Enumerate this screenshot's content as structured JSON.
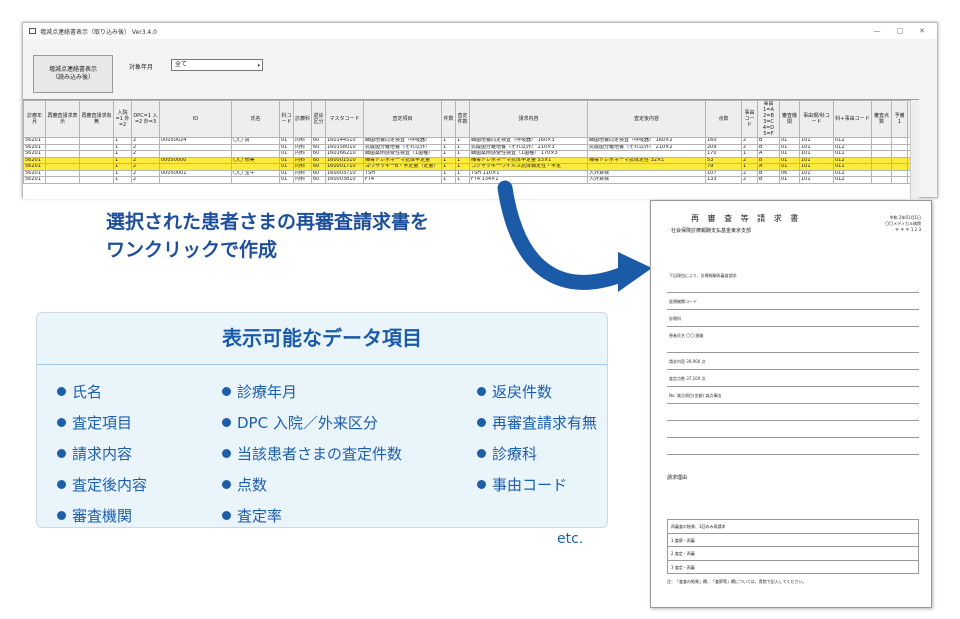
{
  "window": {
    "title": "増減点連絡書表示（取り込み後） Ver3.4.0",
    "controls": [
      "—",
      "□",
      "✕"
    ]
  },
  "toolbar": {
    "button_label": "増減点連絡書表示\n（読み込み後）",
    "year_label": "対象年月",
    "year_value": "全て"
  },
  "table": {
    "headers": [
      "診療年月",
      "再審査請求表示",
      "再審査請求有無",
      "入院=1 外=2",
      "DPC=1 入=2 外=3",
      "ID",
      "氏名",
      "科コード",
      "診療科",
      "返戻区分",
      "マスタコード",
      "査定項目",
      "件数",
      "査定件数",
      "請求内容",
      "査定後内容",
      "点数",
      "事由コード",
      "事由 1=A 2=B 3=C 4=D 5=F",
      "審査機関",
      "事由規/科コード",
      "科+事由コード",
      "審査点数",
      "予備1",
      "予備2"
    ],
    "rows": [
      {
        "hl": false,
        "c": [
          "56201",
          "",
          "",
          "1",
          "2",
          "00050024",
          "〇〇 真",
          "01",
          "内科",
          "60",
          "160144510",
          "細菌培養同定検査（呼吸器）",
          "1",
          "1",
          "細菌培養同定検査（呼吸器） 160×3",
          "細菌培養同定検査（呼吸器） 160×2",
          "160",
          "2",
          "B",
          "01",
          "101",
          "012",
          "",
          "",
          ""
        ]
      },
      {
        "hl": false,
        "c": [
          "56201",
          "",
          "",
          "1",
          "2",
          "",
          "",
          "01",
          "内科",
          "60",
          "160158010",
          "抗酸菌分離培養（それ以外）",
          "1",
          "1",
          "抗酸菌分離培養（それ以外） 210×3",
          "抗酸菌分離培養（それ以外） 210×2",
          "209",
          "2",
          "B",
          "01",
          "101",
          "012",
          "",
          "",
          ""
        ]
      },
      {
        "hl": false,
        "c": [
          "56201",
          "",
          "",
          "1",
          "2",
          "",
          "",
          "01",
          "内科",
          "60",
          "160166210",
          "細菌薬剤感受性検査（1菌種）",
          "1",
          "1",
          "細菌薬剤感受性検査（1菌種） 170×3",
          "",
          "170",
          "1",
          "A",
          "01",
          "101",
          "011",
          "",
          "",
          ""
        ]
      },
      {
        "hl": true,
        "c": [
          "56201",
          "",
          "",
          "1",
          "2",
          "00050000",
          "〇〇 修美",
          "01",
          "内科",
          "60",
          "160001510",
          "梅毒トレポネーマ抗体半定量",
          "1",
          "1",
          "梅毒トレポネーマ抗体半定量 53×1",
          "梅毒トレポネーマ抗体定性 32×1",
          "53",
          "2",
          "B",
          "01",
          "101",
          "012",
          "",
          "",
          ""
        ]
      },
      {
        "hl": true,
        "c": [
          "56201",
          "",
          "",
          "1",
          "2",
          "",
          "",
          "01",
          "内科",
          "60",
          "160001710",
          "ヨウサッキーB・半定量（定量）",
          "1",
          "1",
          "コクサッキーウイルス抗体価定性・半定",
          "",
          "79",
          "1",
          "A",
          "01",
          "101",
          "011",
          "",
          "",
          ""
        ]
      },
      {
        "hl": false,
        "c": [
          "56201",
          "",
          "",
          "1",
          "2",
          "00050001",
          "〇〇 宝午",
          "01",
          "内科",
          "60",
          "160003710",
          "TSH",
          "1",
          "1",
          "TSH 110×1",
          "入外算検",
          "107",
          "2",
          "B",
          "06",
          "101",
          "012",
          "",
          "",
          ""
        ]
      },
      {
        "hl": false,
        "c": [
          "56201",
          "",
          "",
          "1",
          "2",
          "",
          "",
          "01",
          "内科",
          "60",
          "160003810",
          "FT4",
          "1",
          "1",
          "FT4 134×1",
          "入外算検",
          "133",
          "2",
          "B",
          "01",
          "101",
          "012",
          "",
          "",
          ""
        ]
      }
    ]
  },
  "caption": {
    "line1": "選択された患者さまの再審査請求書を",
    "line2": "ワンクリックで作成"
  },
  "card": {
    "title": "表示可能なデータ項目",
    "col1": [
      "氏名",
      "査定項目",
      "請求内容",
      "査定後内容",
      "審査機関"
    ],
    "col2": [
      "診療年月",
      "DPC 入院／外来区分",
      "当該患者さまの査定件数",
      "点数",
      "査定率"
    ],
    "col3": [
      "返戻件数",
      "再審査請求有無",
      "診療科",
      "事由コード"
    ],
    "etc": "etc."
  },
  "doc": {
    "title": "再 審 査 等 請 求 書",
    "to": "社会保険診療報酬支払基金東京支部",
    "right": "令和 2年01月1日\n〇〇メディカル病院\n〒 〒 〒 1 2 3",
    "req": "請求理由",
    "lines": [
      "下記理由により、診療報酬再審査請求",
      "医療機関コード",
      "診療科",
      "患者氏名 〇〇 圃美",
      "請求内容 39,900 点",
      "査定点数 37,100 点",
      "No. 減点項目(金額) 減点事由",
      "",
      "",
      ""
    ],
    "foot": [
      "再審査の結果、1回のみ再請求",
      "1 査察・再審",
      "2 査定・再審",
      "3 査定・再審"
    ],
    "note": "注：「査査の結果」欄、「査察等」欄については、貴院で記入してください。"
  },
  "colors": {
    "accent": "#1d5ea8",
    "highlight": "#ffeb3b",
    "card_bg": "#e9f4fb"
  }
}
